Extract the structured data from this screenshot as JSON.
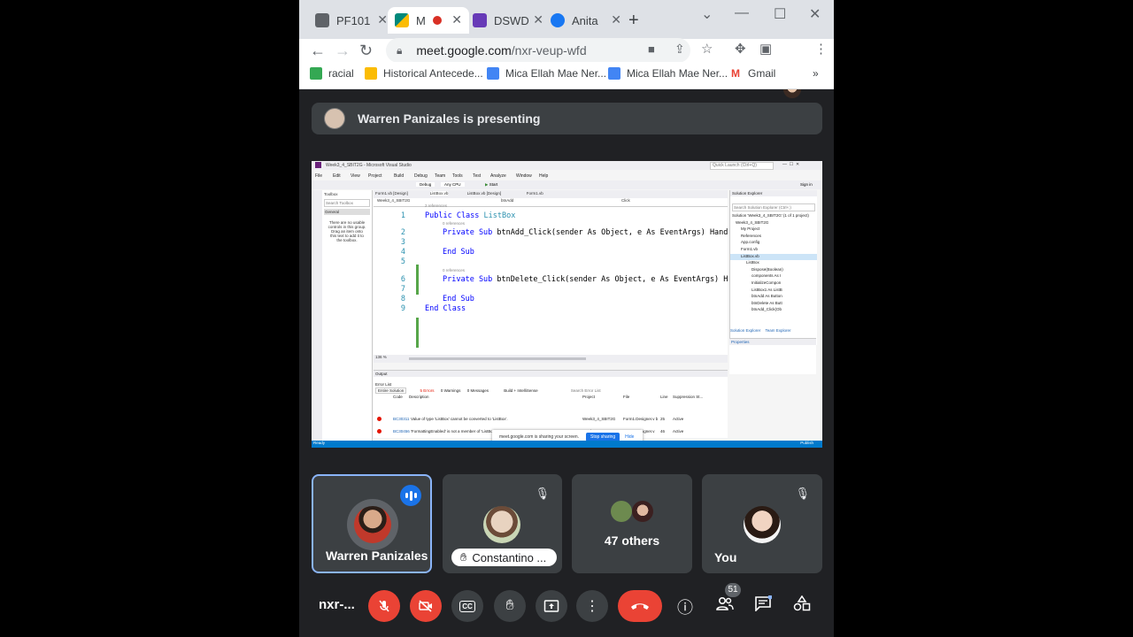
{
  "browser": {
    "tabs": [
      {
        "label": "PF101",
        "icon": "document-icon",
        "color": "#5f6368"
      },
      {
        "label": "M",
        "icon": "meet-icon",
        "color": "#00897b",
        "recording": true
      },
      {
        "label": "DSWD",
        "icon": "forms-icon",
        "color": "#673ab7"
      },
      {
        "label": "Anita",
        "icon": "facebook-icon",
        "color": "#1877f2"
      }
    ],
    "new_tab": "+",
    "url_host": "meet.google.com",
    "url_path": "/nxr-veup-wfd",
    "bookmarks": [
      {
        "label": "racial",
        "color": "#34a853"
      },
      {
        "label": "Historical Antecede...",
        "color": "#fbbc04"
      },
      {
        "label": "Mica Ellah Mae Ner...",
        "color": "#4285f4"
      },
      {
        "label": "Mica Ellah Mae Ner...",
        "color": "#4285f4"
      },
      {
        "label": "Gmail",
        "color": "#ea4335"
      }
    ],
    "more_bookmarks": "»"
  },
  "meet": {
    "presenting_text": "Warren Panizales is presenting",
    "meeting_code": "nxr-...",
    "participants_count": "51",
    "tiles": [
      {
        "name": "Warren Panizales"
      },
      {
        "name": "Constantino ..."
      },
      {
        "name": "47 others"
      },
      {
        "name": "You"
      }
    ]
  },
  "vs": {
    "title": "Week3_4_SBIT2G - Microsoft Visual Studio",
    "quick_launch": "Quick Launch (Ctrl+Q)",
    "sign_in": "Sign in",
    "menu": [
      "File",
      "Edit",
      "View",
      "Project",
      "Build",
      "Debug",
      "Team",
      "Tools",
      "Test",
      "Analyze",
      "Window",
      "Help"
    ],
    "debug_config": "Debug",
    "cpu": "Any CPU",
    "start": "Start",
    "doc_tabs": [
      "Form1.vb [Design]",
      "ListBox.vb",
      "ListBox.vb [Design]",
      "Form1.vb"
    ],
    "nav_project": "Week3_4_SBIT2G",
    "nav_object": "btnAdd",
    "nav_event": "Click",
    "toolbox_title": "Toolbox",
    "toolbox_search": "Search Toolbox",
    "toolbox_group": "General",
    "toolbox_empty": "There are no usable controls in this group. Drag an item onto this text to add it to the toolbox.",
    "refs_2": "2 references",
    "refs_0": "0 references",
    "code": [
      {
        "n": "1",
        "kw": "Public Class ",
        "ty": "ListBox",
        "rest": ""
      },
      {
        "n": "2",
        "kw": "Private Sub ",
        "ty": "",
        "rest": "btnAdd_Click(sender As Object, e As EventArgs) Hand"
      },
      {
        "n": "3",
        "kw": "",
        "ty": "",
        "rest": ""
      },
      {
        "n": "4",
        "kw": "End Sub",
        "ty": "",
        "rest": ""
      },
      {
        "n": "5",
        "kw": "",
        "ty": "",
        "rest": ""
      },
      {
        "n": "6",
        "kw": "Private Sub ",
        "ty": "",
        "rest": "btnDelete_Click(sender As Object, e As EventArgs) H"
      },
      {
        "n": "7",
        "kw": "",
        "ty": "",
        "rest": ""
      },
      {
        "n": "8",
        "kw": "End Sub",
        "ty": "",
        "rest": ""
      },
      {
        "n": "9",
        "kw": "End Class",
        "ty": "",
        "rest": ""
      }
    ],
    "zoom": "136 %",
    "solution_title": "Solution Explorer",
    "solution_search": "Search Solution Explorer (Ctrl+;)",
    "solution_items": [
      "Solution 'Week3_4_SBIT2G' (1 of 1 project)",
      "Week3_4_SBIT2G",
      "My Project",
      "References",
      "App.config",
      "Form1.vb",
      "ListBox.vb",
      "ListBox",
      "Dispose(Boolean)",
      "components As I",
      "InitializeCompon",
      "ListBox1 As ListB",
      "btnAdd As Button",
      "btnDelete As Butt",
      "btnAdd_Click(Ob"
    ],
    "solution_tabs": [
      "Solution Explorer",
      "Team Explorer"
    ],
    "properties_title": "Properties",
    "output_title": "Output",
    "error_list_title": "Error List",
    "error_scope": "Entire Solution",
    "errors_btn": "5 Errors",
    "warnings_btn": "0 Warnings",
    "messages_btn": "0 Messages",
    "build_filter": "Build + IntelliSense",
    "search_errors": "Search Error List",
    "error_cols": [
      "Code",
      "Description",
      "Project",
      "File",
      "Line",
      "Suppression St..."
    ],
    "errors": [
      {
        "code": "BC30311",
        "desc": "Value of type 'ListBox' cannot be converted to 'ListBox'.",
        "project": "Week3_4_SBIT2G",
        "file": "Form1.Designer.v b",
        "line": "25",
        "state": "Active"
      },
      {
        "code": "BC30456",
        "desc": "'FormattingEnabled' is not a member of 'ListBox'.",
        "project": "Week3_4_SBIT2G",
        "file": "Form1.Designer.v",
        "line": "46",
        "state": "Active"
      }
    ],
    "status_ready": "Ready",
    "status_publish": "Publish",
    "sharing_text": "meet.google.com is sharing your screen.",
    "stop_sharing": "Stop sharing",
    "hide": "Hide"
  }
}
